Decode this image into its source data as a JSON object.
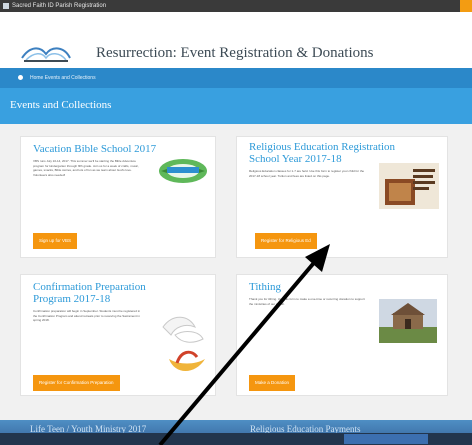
{
  "window": {
    "title": "Sacred Faith ID Parish Registration"
  },
  "header": {
    "logo_name": "parish-logo",
    "title": "Resurrection: Event Registration & Donations"
  },
  "breadcrumb": {
    "text": "Home  Events and Collections"
  },
  "section": {
    "title": "Events and Collections"
  },
  "cards": [
    {
      "title_lines": [
        "Vacation Bible School 2017"
      ],
      "description": "VBS runs July 10-14, 2017. This summer we'll be starting the Bible Adventure program for kindergarten through fifth grade. Join us for a week of crafts, music, games, snacks, Bible stories, and lots of fun as we learn about God's love. Volunteers also needed!",
      "button": "Sign up for VBS"
    },
    {
      "title_lines": [
        "Religious Education Registration",
        "School Year 2017-18"
      ],
      "description": "Religious Education classes for 1-7 are held. Use this form to register your child for the 2017-18 school year. Tuition and fees are listed on this page.",
      "button": "Register for Religious Ed"
    },
    {
      "title_lines": [
        "Confirmation Preparation",
        "Program 2017-18"
      ],
      "description": "Confirmation preparation will begin in September. Students must be registered in the Confirmation Program and attend retreats prior to receiving the Sacrament in spring 2018.",
      "button": "Register for Confirmation Preparation"
    },
    {
      "title_lines": [
        "Tithing"
      ],
      "description": "Thank you for tithing. Use this form to make a one-time or recurring donation to support the ministries of our parish.",
      "button": "Make a Donation"
    }
  ],
  "bottom_cards": {
    "left": "Life Teen / Youth Ministry 2017",
    "right": "Religious Education Payments"
  },
  "icons": {
    "cards": [
      "vbs-logo-icon",
      "religious-education-book-icon",
      "dove-confirmation-icon",
      "church-photo-icon"
    ]
  },
  "colors": {
    "accent": "#2b88c9",
    "section": "#39a0e0",
    "button": "#f5960f",
    "title": "#2d9ad8"
  }
}
